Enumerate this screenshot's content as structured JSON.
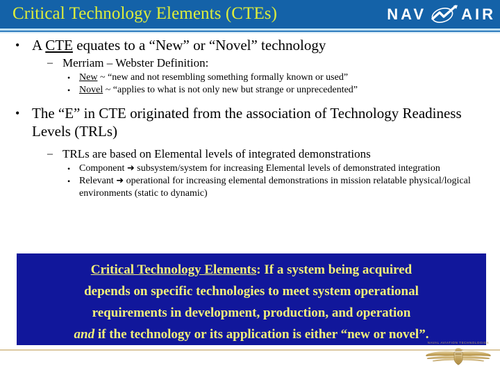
{
  "header": {
    "title": "Critical Technology Elements (CTEs)",
    "logo": {
      "left_text": "NAV",
      "right_text": "AIR",
      "mark_name": "navair-swoosh-emblem"
    },
    "background_color": "#1462A8",
    "title_color": "#DFEE3A"
  },
  "body": {
    "bullet_glyph_level1": "•",
    "bullet_glyph_level2": "–",
    "bullet_glyph_level3": "•",
    "arrow_glyph": "➜",
    "items": [
      {
        "level": 1,
        "pre": "A ",
        "underlined": "CTE",
        "post": " equates to a “New” or “Novel” technology"
      },
      {
        "level": 2,
        "text": "Merriam – Webster Definition:"
      },
      {
        "level": 3,
        "underlined": "New",
        "post": " ~ “new and not resembling something formally known or used”"
      },
      {
        "level": 3,
        "underlined": "Novel",
        "post": " ~ “applies to what is not only new but strange or unprecedented”"
      },
      {
        "level": 1,
        "text": "The “E” in CTE originated from the association of Technology Readiness Levels (TRLs)"
      },
      {
        "level": 2,
        "text": "TRLs are based on Elemental levels of integrated demonstrations"
      },
      {
        "level": 3,
        "pre": "Component ",
        "post": " subsystem/system for increasing Elemental levels of demonstrated integration"
      },
      {
        "level": 3,
        "pre": "Relevant ",
        "post": " operational for increasing elemental demonstrations in mission relatable physical/logical environments (static to dynamic)"
      }
    ]
  },
  "callout": {
    "background_color": "#11179B",
    "text_color": "#F2F07A",
    "line1_underlined": "Critical Technology Elements",
    "line1_rest": ":  If a system being acquired",
    "line2": "depends on specific technologies to meet system operational",
    "line3_pre": "requirements in development, production, and ",
    "line3_italic": "o",
    "line3_post": "peration",
    "line4_italic": "and",
    "line4_rest": " if the technology or its application is either “new or novel”."
  },
  "footer": {
    "emblem_caption": "NAVAL AVIATION TECHNOLOGIES",
    "emblem_name": "naval-aviator-wings-emblem",
    "rule_color": "#DCC9A0"
  }
}
